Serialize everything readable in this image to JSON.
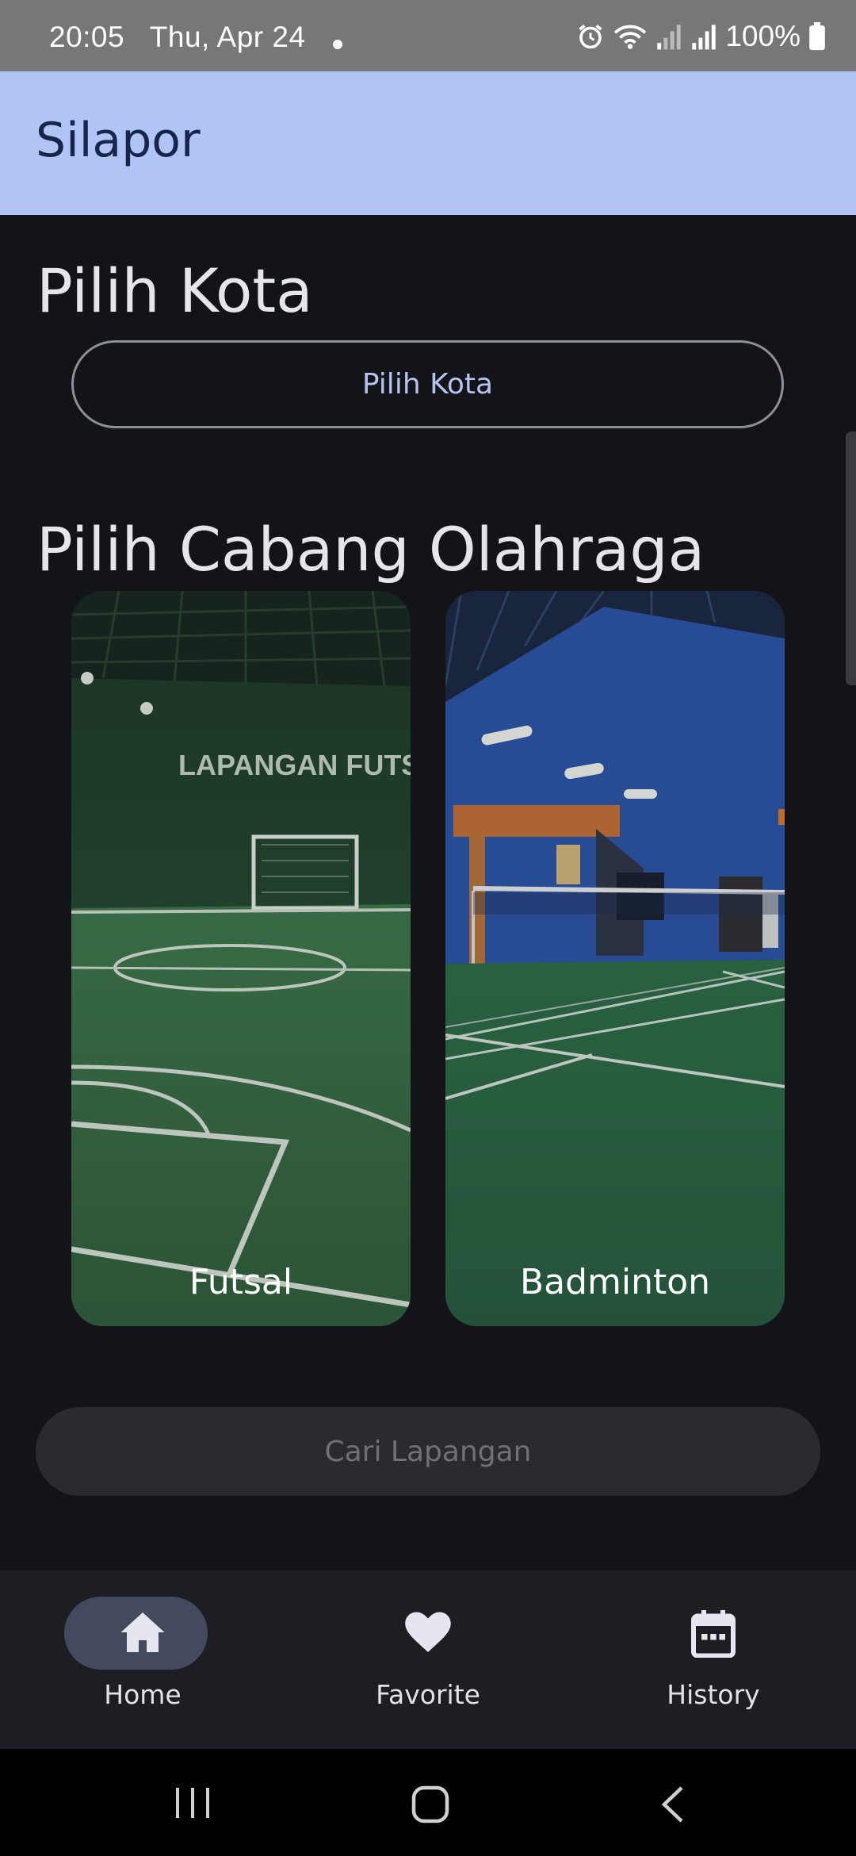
{
  "status_bar": {
    "time": "20:05",
    "date": "Thu, Apr 24",
    "battery": "100%",
    "icons": [
      "alarm-icon",
      "wifi-icon",
      "signal-icon",
      "signal-icon",
      "battery-icon"
    ]
  },
  "app_bar": {
    "title": "Silapor"
  },
  "city_section": {
    "title": "Pilih Kota",
    "button_label": "Pilih Kota"
  },
  "sport_section": {
    "title": "Pilih Cabang Olahraga",
    "cards": [
      {
        "label": "Futsal",
        "image_text": "LAPANGAN FUTS"
      },
      {
        "label": "Badminton"
      }
    ]
  },
  "search_button": {
    "label": "Cari Lapangan"
  },
  "bottom_nav": {
    "items": [
      {
        "label": "Home",
        "icon": "home-icon",
        "active": true
      },
      {
        "label": "Favorite",
        "icon": "heart-icon",
        "active": false
      },
      {
        "label": "History",
        "icon": "calendar-icon",
        "active": false
      }
    ]
  },
  "colors": {
    "background": "#131417",
    "app_bar": "#b0c4f6",
    "accent_text": "#b4c4f2",
    "nav_bar": "#1d1e23",
    "active_pill": "#444a5e"
  }
}
